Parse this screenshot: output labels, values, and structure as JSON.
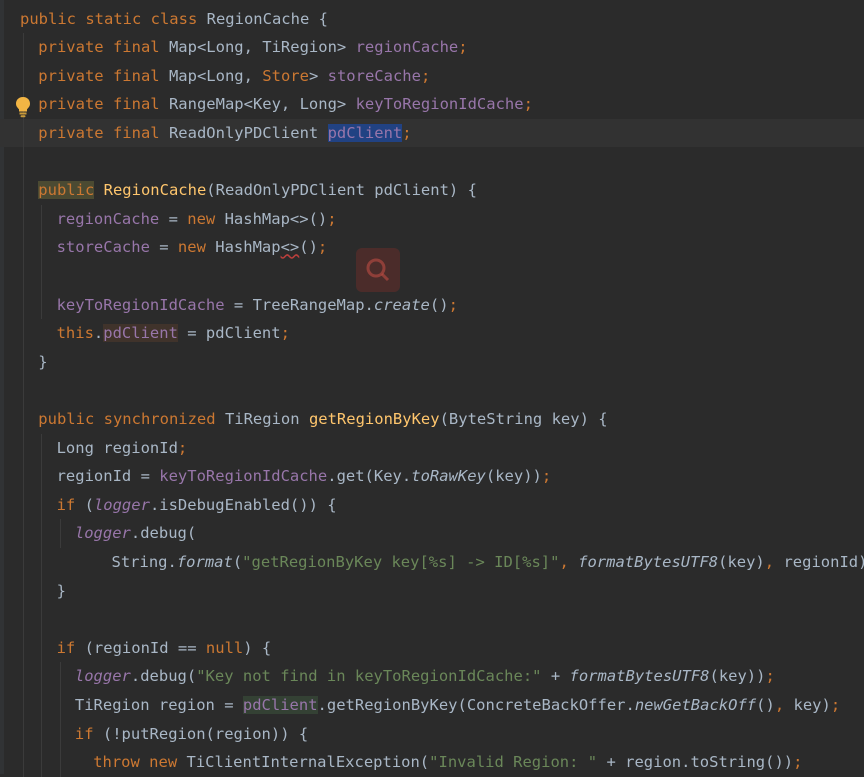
{
  "editor": {
    "language": "java",
    "colors": {
      "background": "#2b2b2b",
      "keyword": "#cc7832",
      "text": "#a9b7c6",
      "field": "#9876aa",
      "method_decl": "#ffc66d",
      "string": "#6a8759",
      "selection": "#214283"
    },
    "lines": [
      {
        "indent": 0,
        "tokens": [
          [
            "public static class ",
            "k"
          ],
          [
            "RegionCache {",
            "t"
          ]
        ]
      },
      {
        "indent": 1,
        "tokens": [
          [
            "private final ",
            "k"
          ],
          [
            "Map<Long, TiRegion> ",
            "t"
          ],
          [
            "regionCache",
            "f"
          ],
          [
            ";",
            "p"
          ]
        ]
      },
      {
        "indent": 1,
        "tokens": [
          [
            "private final ",
            "k"
          ],
          [
            "Map<Long, ",
            "t"
          ],
          [
            "Store",
            "k"
          ],
          [
            "> ",
            "t"
          ],
          [
            "storeCache",
            "f"
          ],
          [
            ";",
            "p"
          ]
        ]
      },
      {
        "indent": 1,
        "tokens": [
          [
            "private final ",
            "k"
          ],
          [
            "RangeMap<Key, Long> ",
            "t"
          ],
          [
            "keyToRegionIdCache",
            "f"
          ],
          [
            ";",
            "p"
          ]
        ],
        "gutter_icon": "lightbulb-icon"
      },
      {
        "indent": 1,
        "current": true,
        "tokens": [
          [
            "private final ",
            "k"
          ],
          [
            "ReadOnlyPDClient ",
            "t"
          ],
          [
            "pdClient",
            "f hl-sel"
          ],
          [
            ";",
            "p"
          ]
        ]
      },
      {
        "indent": 0,
        "tokens": []
      },
      {
        "indent": 1,
        "tokens": [
          [
            "public",
            "k hl-pub"
          ],
          [
            " ",
            "t"
          ],
          [
            "RegionCache",
            "m"
          ],
          [
            "(ReadOnlyPDClient pdClient) {",
            "t"
          ]
        ]
      },
      {
        "indent": 2,
        "tokens": [
          [
            "regionCache",
            "f"
          ],
          [
            " = ",
            "t"
          ],
          [
            "new ",
            "k"
          ],
          [
            "HashMap<>()",
            "t"
          ],
          [
            ";",
            "p"
          ]
        ]
      },
      {
        "indent": 2,
        "tokens": [
          [
            "storeCache",
            "f"
          ],
          [
            " = ",
            "t"
          ],
          [
            "new ",
            "k"
          ],
          [
            "HashMap",
            "t"
          ],
          [
            "<>",
            "t err"
          ],
          [
            "()",
            "t"
          ],
          [
            ";",
            "p"
          ]
        ]
      },
      {
        "indent": 0,
        "tokens": []
      },
      {
        "indent": 2,
        "tokens": [
          [
            "keyToRegionIdCache",
            "f"
          ],
          [
            " = TreeRangeMap.",
            "t"
          ],
          [
            "create",
            "st"
          ],
          [
            "()",
            "t"
          ],
          [
            ";",
            "p"
          ]
        ]
      },
      {
        "indent": 2,
        "tokens": [
          [
            "this",
            "k"
          ],
          [
            ".",
            "t"
          ],
          [
            "pdClient",
            "f hl-write"
          ],
          [
            " = pdClient",
            "t"
          ],
          [
            ";",
            "p"
          ]
        ]
      },
      {
        "indent": 1,
        "tokens": [
          [
            "}",
            "t"
          ]
        ]
      },
      {
        "indent": 0,
        "tokens": []
      },
      {
        "indent": 1,
        "tokens": [
          [
            "public synchronized ",
            "k"
          ],
          [
            "TiRegion ",
            "t"
          ],
          [
            "getRegionByKey",
            "m"
          ],
          [
            "(ByteString key) {",
            "t"
          ]
        ]
      },
      {
        "indent": 2,
        "tokens": [
          [
            "Long regionId",
            "t"
          ],
          [
            ";",
            "p"
          ]
        ]
      },
      {
        "indent": 2,
        "tokens": [
          [
            "regionId = ",
            "t"
          ],
          [
            "keyToRegionIdCache",
            "f"
          ],
          [
            ".get(Key.",
            "t"
          ],
          [
            "toRawKey",
            "st"
          ],
          [
            "(key))",
            "t"
          ],
          [
            ";",
            "p"
          ]
        ]
      },
      {
        "indent": 2,
        "tokens": [
          [
            "if ",
            "k"
          ],
          [
            "(",
            "t"
          ],
          [
            "logger",
            "fi"
          ],
          [
            ".isDebugEnabled()) {",
            "t"
          ]
        ]
      },
      {
        "indent": 3,
        "tokens": [
          [
            "logger",
            "fi"
          ],
          [
            ".debug(",
            "t"
          ]
        ]
      },
      {
        "indent": 5,
        "tokens": [
          [
            "String.",
            "t"
          ],
          [
            "format",
            "st"
          ],
          [
            "(",
            "t"
          ],
          [
            "\"getRegionByKey key[%s] -> ID[%s]\"",
            "s"
          ],
          [
            ", ",
            "p"
          ],
          [
            "formatBytesUTF8",
            "st"
          ],
          [
            "(key)",
            "t"
          ],
          [
            ", ",
            "p"
          ],
          [
            "regionId))",
            "t"
          ],
          [
            ";",
            "p"
          ]
        ]
      },
      {
        "indent": 2,
        "tokens": [
          [
            "}",
            "t"
          ]
        ]
      },
      {
        "indent": 0,
        "tokens": []
      },
      {
        "indent": 2,
        "tokens": [
          [
            "if ",
            "k"
          ],
          [
            "(regionId == ",
            "t"
          ],
          [
            "null",
            "k"
          ],
          [
            ") {",
            "t"
          ]
        ]
      },
      {
        "indent": 3,
        "tokens": [
          [
            "logger",
            "fi"
          ],
          [
            ".debug(",
            "t"
          ],
          [
            "\"Key not find in keyToRegionIdCache:\"",
            "s"
          ],
          [
            " + ",
            "t"
          ],
          [
            "formatBytesUTF8",
            "st"
          ],
          [
            "(key))",
            "t"
          ],
          [
            ";",
            "p"
          ]
        ]
      },
      {
        "indent": 3,
        "tokens": [
          [
            "TiRegion region = ",
            "t"
          ],
          [
            "pdClient",
            "f hl-usage"
          ],
          [
            ".getRegionByKey(ConcreteBackOffer.",
            "t"
          ],
          [
            "newGetBackOff",
            "st"
          ],
          [
            "()",
            "t"
          ],
          [
            ", ",
            "p"
          ],
          [
            "key)",
            "t"
          ],
          [
            ";",
            "p"
          ]
        ]
      },
      {
        "indent": 3,
        "tokens": [
          [
            "if ",
            "k"
          ],
          [
            "(!putRegion(region)) {",
            "t"
          ]
        ]
      },
      {
        "indent": 4,
        "tokens": [
          [
            "throw new ",
            "k"
          ],
          [
            "TiClientInternalException(",
            "t"
          ],
          [
            "\"Invalid Region: \"",
            "s"
          ],
          [
            " + region.toString())",
            "t"
          ],
          [
            ";",
            "p"
          ]
        ]
      }
    ]
  }
}
